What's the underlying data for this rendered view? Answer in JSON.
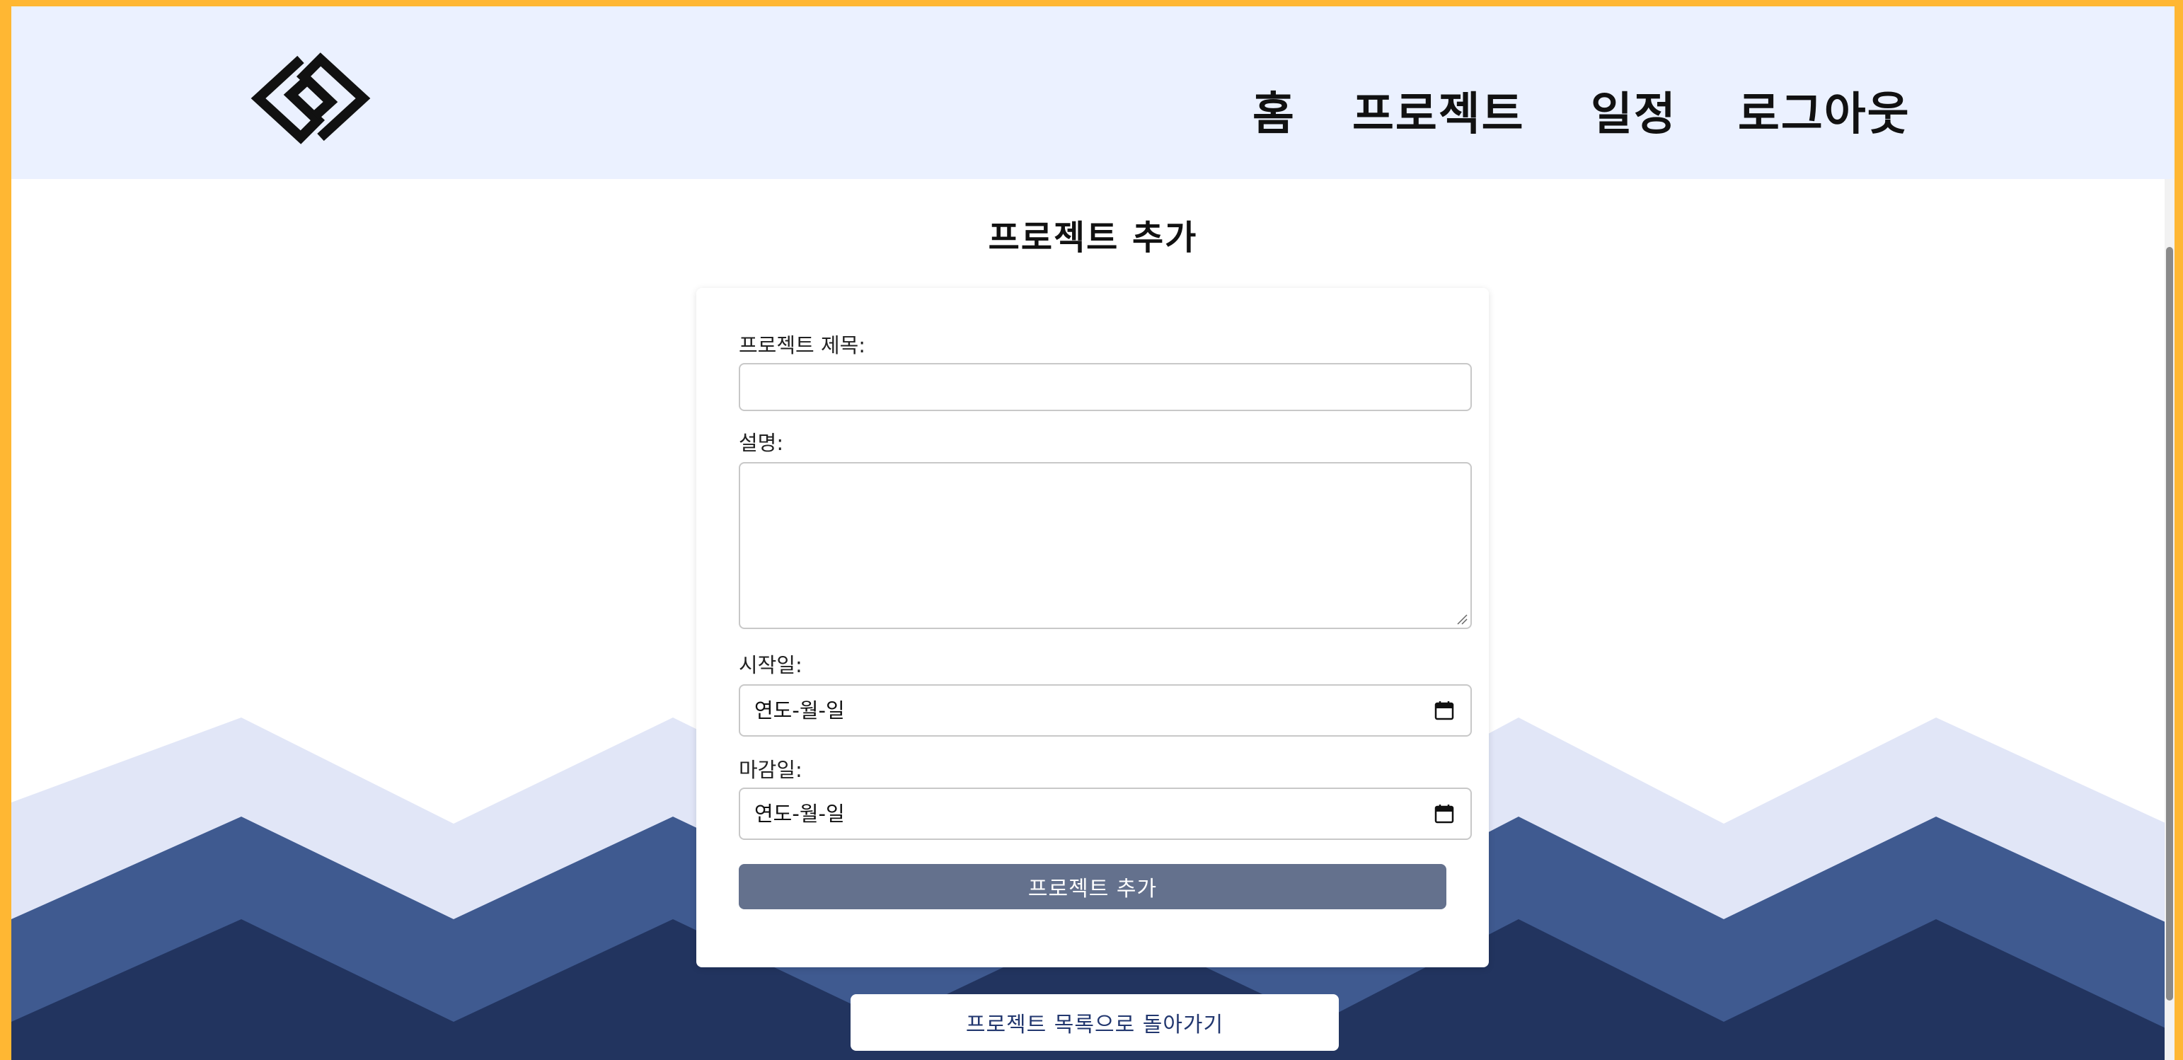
{
  "header": {
    "logo_icon": "diamond-link-logo-icon",
    "nav": {
      "home": "홈",
      "projects": "프로젝트",
      "schedule": "일정",
      "logout": "로그아웃"
    }
  },
  "page": {
    "title": "프로젝트 추가"
  },
  "form": {
    "title_label": "프로젝트 제목:",
    "title_value": "",
    "description_label": "설명:",
    "description_value": "",
    "start_date_label": "시작일:",
    "start_date_value": "연도-월-일",
    "due_date_label": "마감일:",
    "due_date_value": "연도-월-일",
    "submit_label": "프로젝트 추가"
  },
  "footer": {
    "back_label": "프로젝트 목록으로 돌아가기"
  },
  "colors": {
    "frame_border": "#ffb733",
    "header_bg": "#ebf1ff",
    "wave_light": "#e1e6f7",
    "wave_mid": "#3f5a90",
    "wave_dark": "#22345f",
    "submit_bg": "#64718d",
    "back_text": "#22376f"
  }
}
